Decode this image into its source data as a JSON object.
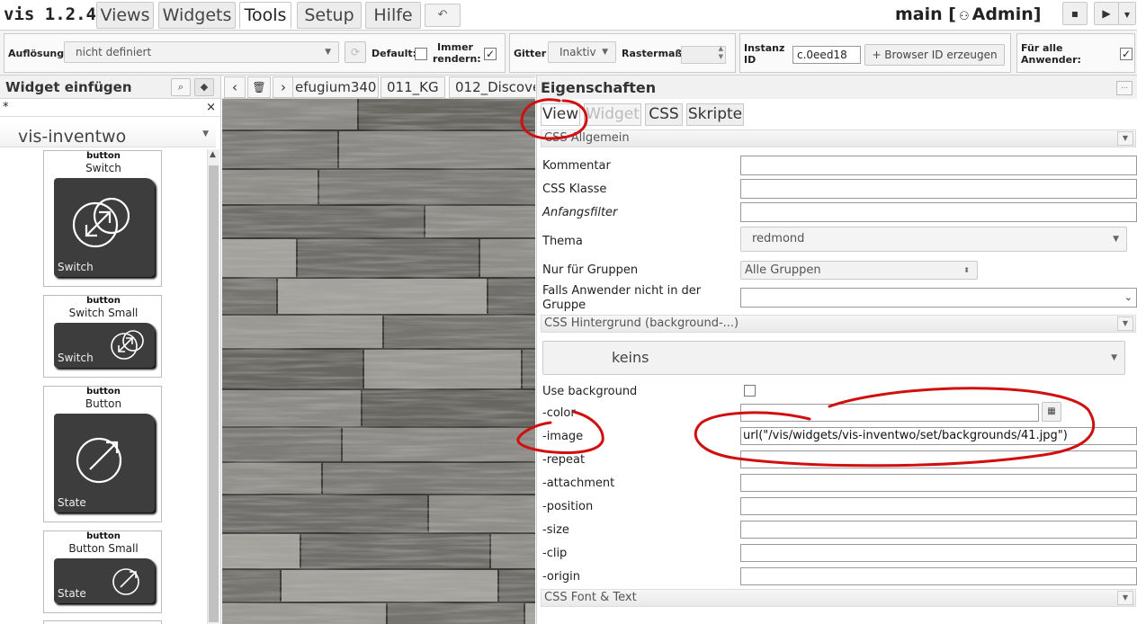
{
  "app": {
    "title": "vis 1.2.4"
  },
  "menu": {
    "tabs": [
      "Views",
      "Widgets",
      "Tools",
      "Setup",
      "Hilfe"
    ],
    "active": "Tools",
    "undo_icon": "undo-icon"
  },
  "header_right": {
    "view_name": "main [",
    "user": "Admin]",
    "user_icon": "user-icon"
  },
  "toolbar": {
    "resolution_label": "Auflösung:",
    "resolution_value": "nicht definiert",
    "default_label": "Default:",
    "default_checked": false,
    "always_render_label": "Immer rendern:",
    "always_render_checked": true,
    "grid_label": "Gitter",
    "grid_value": "Inaktiv",
    "grid_size_label": "Rastermaß:",
    "grid_size_value": "",
    "instance_label": "Instanz ID",
    "instance_value": "c.0eed18",
    "browser_id_button": "+ Browser ID erzeugen",
    "all_users_label": "Für alle Anwender:",
    "all_users_checked": true
  },
  "left_panel": {
    "title": "Widget einfügen",
    "filter_value": "*",
    "filter_clear": "×",
    "widget_set": "vis-inventwo",
    "widgets": [
      {
        "type": "button",
        "name": "Switch",
        "tile_label": "Switch"
      },
      {
        "type": "button",
        "name": "Switch Small",
        "tile_label": "Switch"
      },
      {
        "type": "button",
        "name": "Button",
        "tile_label": "State"
      },
      {
        "type": "button",
        "name": "Button Small",
        "tile_label": "State"
      }
    ]
  },
  "view_tabs": [
    "efugium340",
    "011_KG",
    "012_Discove"
  ],
  "properties": {
    "title": "Eigenschaften",
    "tabs": [
      "View",
      "Widget",
      "CSS",
      "Skripte"
    ],
    "active_tab": "View",
    "disabled_tab": "Widget",
    "sections": {
      "general": "CSS Allgemein",
      "background": "CSS Hintergrund (background-...)",
      "font": "CSS Font & Text"
    },
    "general_fields": [
      {
        "label": "Kommentar",
        "value": ""
      },
      {
        "label": "CSS Klasse",
        "value": ""
      },
      {
        "label": "Anfangsfilter",
        "value": ""
      }
    ],
    "theme_label": "Thema",
    "theme_value": "redmond",
    "groups_label": "Nur für Gruppen",
    "groups_value": "Alle Gruppen",
    "not_in_group_label": "Falls Anwender nicht in der Gruppe",
    "not_in_group_value": "",
    "bg_preset": "keins",
    "use_background_label": "Use background",
    "use_background_checked": false,
    "bg_fields": [
      {
        "label": "-color",
        "value": ""
      },
      {
        "label": "-image",
        "value": "url(\"/vis/widgets/vis-inventwo/set/backgrounds/41.jpg\")"
      },
      {
        "label": "-repeat",
        "value": ""
      },
      {
        "label": "-attachment",
        "value": ""
      },
      {
        "label": "-position",
        "value": ""
      },
      {
        "label": "-size",
        "value": ""
      },
      {
        "label": "-clip",
        "value": ""
      },
      {
        "label": "-origin",
        "value": ""
      }
    ]
  },
  "colors": {
    "annotation": "#d01010",
    "tile": "#3d3d3d"
  }
}
